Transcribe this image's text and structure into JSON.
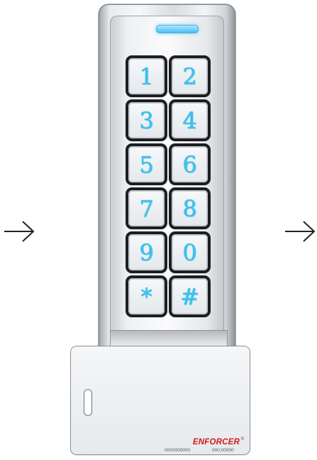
{
  "keypad": {
    "keys": [
      {
        "label": "1"
      },
      {
        "label": "2"
      },
      {
        "label": "3"
      },
      {
        "label": "4"
      },
      {
        "label": "5"
      },
      {
        "label": "6"
      },
      {
        "label": "7"
      },
      {
        "label": "8"
      },
      {
        "label": "9"
      },
      {
        "label": "0"
      },
      {
        "label": "*"
      },
      {
        "label": "#"
      }
    ],
    "led_color": "#6fd0ff",
    "key_text_color": "#3cc1ee"
  },
  "card": {
    "brand": "ENFORCER",
    "brand_mark": "®",
    "number_left": "0000000000",
    "number_right": "000,00000",
    "brand_color": "#d11b1b"
  },
  "icons": {
    "left": "arrow-right-icon",
    "right": "arrow-right-icon"
  }
}
